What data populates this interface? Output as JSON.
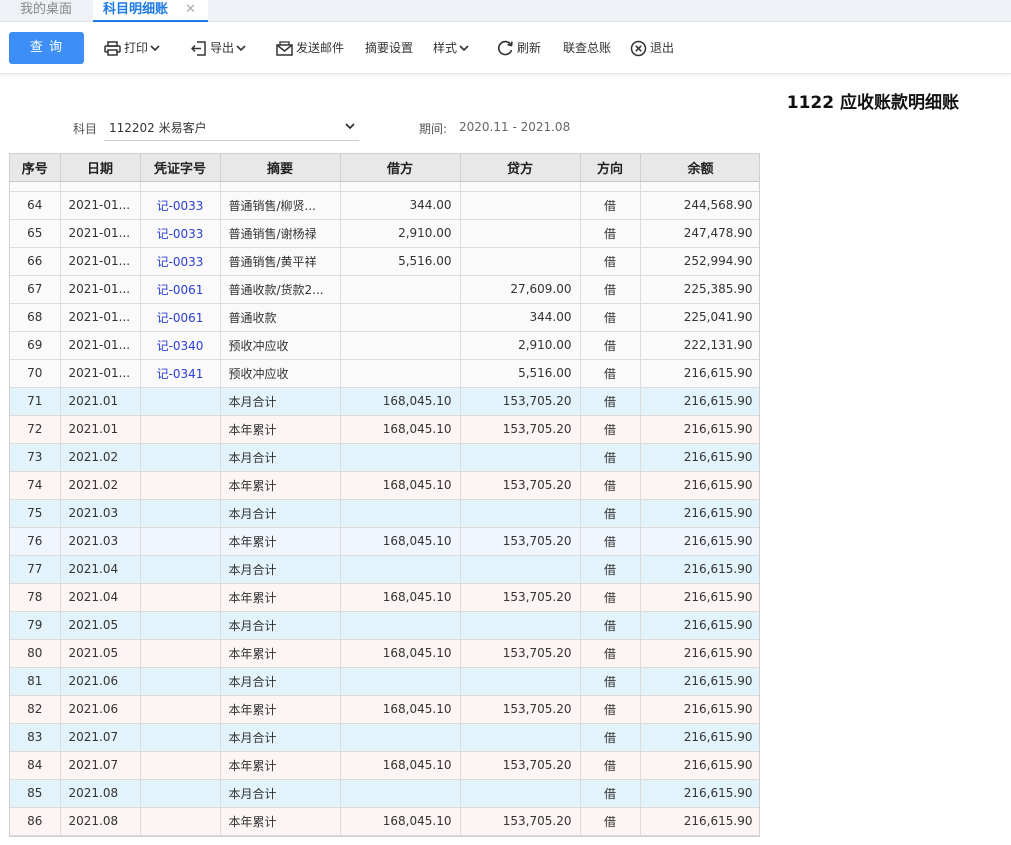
{
  "tabs": [
    {
      "label": "我的桌面"
    },
    {
      "label": "科目明细账",
      "close": "✕"
    }
  ],
  "toolbar": {
    "query": "查 询",
    "print": "打印",
    "export": "导出",
    "email": "发送邮件",
    "summary_settings": "摘要设置",
    "style": "样式",
    "refresh": "刷新",
    "ledger": "联查总账",
    "exit": "退出"
  },
  "report": {
    "title": "1122 应收账款明细账",
    "subject_label": "科目",
    "subject_value": "112202 米易客户",
    "period_label": "期间:",
    "period_value": "2020.11 - 2021.08"
  },
  "table": {
    "headers": [
      "序号",
      "日期",
      "凭证字号",
      "摘要",
      "借方",
      "贷方",
      "方向",
      "余额"
    ],
    "rows": [
      {
        "type": "normal",
        "seq": "64",
        "date": "2021-01...",
        "voucher": "记-0033",
        "summary": "普通销售/柳贤...",
        "debit": "344.00",
        "credit": "",
        "dir": "借",
        "balance": "244,568.90"
      },
      {
        "type": "normal",
        "seq": "65",
        "date": "2021-01...",
        "voucher": "记-0033",
        "summary": "普通销售/谢杨禄",
        "debit": "2,910.00",
        "credit": "",
        "dir": "借",
        "balance": "247,478.90"
      },
      {
        "type": "normal",
        "seq": "66",
        "date": "2021-01...",
        "voucher": "记-0033",
        "summary": "普通销售/黄平祥",
        "debit": "5,516.00",
        "credit": "",
        "dir": "借",
        "balance": "252,994.90"
      },
      {
        "type": "normal",
        "seq": "67",
        "date": "2021-01...",
        "voucher": "记-0061",
        "summary": "普通收款/货款2...",
        "debit": "",
        "credit": "27,609.00",
        "dir": "借",
        "balance": "225,385.90"
      },
      {
        "type": "normal",
        "seq": "68",
        "date": "2021-01...",
        "voucher": "记-0061",
        "summary": "普通收款",
        "debit": "",
        "credit": "344.00",
        "dir": "借",
        "balance": "225,041.90"
      },
      {
        "type": "normal",
        "seq": "69",
        "date": "2021-01...",
        "voucher": "记-0340",
        "summary": "预收冲应收",
        "debit": "",
        "credit": "2,910.00",
        "dir": "借",
        "balance": "222,131.90"
      },
      {
        "type": "normal",
        "seq": "70",
        "date": "2021-01...",
        "voucher": "记-0341",
        "summary": "预收冲应收",
        "debit": "",
        "credit": "5,516.00",
        "dir": "借",
        "balance": "216,615.90"
      },
      {
        "type": "month",
        "seq": "71",
        "date": "2021.01",
        "voucher": "",
        "summary": "本月合计",
        "debit": "168,045.10",
        "credit": "153,705.20",
        "dir": "借",
        "balance": "216,615.90"
      },
      {
        "type": "year",
        "seq": "72",
        "date": "2021.01",
        "voucher": "",
        "summary": "本年累计",
        "debit": "168,045.10",
        "credit": "153,705.20",
        "dir": "借",
        "balance": "216,615.90"
      },
      {
        "type": "month",
        "seq": "73",
        "date": "2021.02",
        "voucher": "",
        "summary": "本月合计",
        "debit": "",
        "credit": "",
        "dir": "借",
        "balance": "216,615.90"
      },
      {
        "type": "year",
        "seq": "74",
        "date": "2021.02",
        "voucher": "",
        "summary": "本年累计",
        "debit": "168,045.10",
        "credit": "153,705.20",
        "dir": "借",
        "balance": "216,615.90"
      },
      {
        "type": "month",
        "seq": "75",
        "date": "2021.03",
        "voucher": "",
        "summary": "本月合计",
        "debit": "",
        "credit": "",
        "dir": "借",
        "balance": "216,615.90"
      },
      {
        "type": "year-alt",
        "seq": "76",
        "date": "2021.03",
        "voucher": "",
        "summary": "本年累计",
        "debit": "168,045.10",
        "credit": "153,705.20",
        "dir": "借",
        "balance": "216,615.90"
      },
      {
        "type": "month",
        "seq": "77",
        "date": "2021.04",
        "voucher": "",
        "summary": "本月合计",
        "debit": "",
        "credit": "",
        "dir": "借",
        "balance": "216,615.90"
      },
      {
        "type": "year",
        "seq": "78",
        "date": "2021.04",
        "voucher": "",
        "summary": "本年累计",
        "debit": "168,045.10",
        "credit": "153,705.20",
        "dir": "借",
        "balance": "216,615.90"
      },
      {
        "type": "month",
        "seq": "79",
        "date": "2021.05",
        "voucher": "",
        "summary": "本月合计",
        "debit": "",
        "credit": "",
        "dir": "借",
        "balance": "216,615.90"
      },
      {
        "type": "year",
        "seq": "80",
        "date": "2021.05",
        "voucher": "",
        "summary": "本年累计",
        "debit": "168,045.10",
        "credit": "153,705.20",
        "dir": "借",
        "balance": "216,615.90"
      },
      {
        "type": "month",
        "seq": "81",
        "date": "2021.06",
        "voucher": "",
        "summary": "本月合计",
        "debit": "",
        "credit": "",
        "dir": "借",
        "balance": "216,615.90"
      },
      {
        "type": "year",
        "seq": "82",
        "date": "2021.06",
        "voucher": "",
        "summary": "本年累计",
        "debit": "168,045.10",
        "credit": "153,705.20",
        "dir": "借",
        "balance": "216,615.90"
      },
      {
        "type": "month",
        "seq": "83",
        "date": "2021.07",
        "voucher": "",
        "summary": "本月合计",
        "debit": "",
        "credit": "",
        "dir": "借",
        "balance": "216,615.90"
      },
      {
        "type": "year",
        "seq": "84",
        "date": "2021.07",
        "voucher": "",
        "summary": "本年累计",
        "debit": "168,045.10",
        "credit": "153,705.20",
        "dir": "借",
        "balance": "216,615.90"
      },
      {
        "type": "month",
        "seq": "85",
        "date": "2021.08",
        "voucher": "",
        "summary": "本月合计",
        "debit": "",
        "credit": "",
        "dir": "借",
        "balance": "216,615.90"
      },
      {
        "type": "year",
        "seq": "86",
        "date": "2021.08",
        "voucher": "",
        "summary": "本年累计",
        "debit": "168,045.10",
        "credit": "153,705.20",
        "dir": "借",
        "balance": "216,615.90"
      }
    ]
  }
}
